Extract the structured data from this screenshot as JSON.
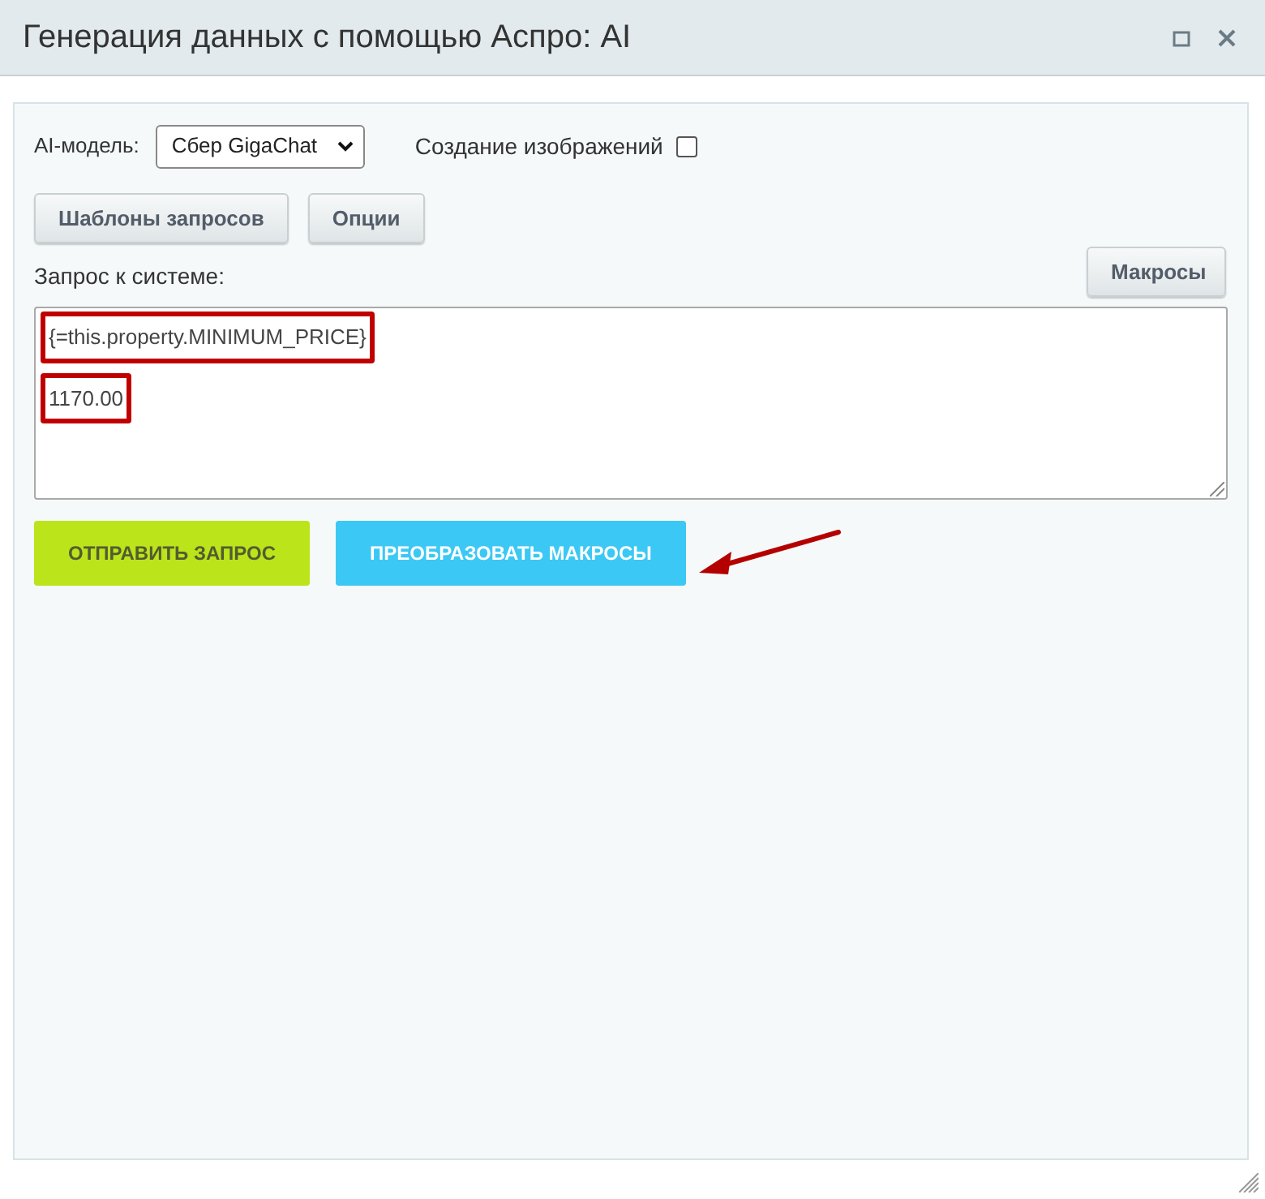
{
  "window": {
    "title": "Генерация данных с помощью Аспро: AI"
  },
  "model": {
    "label": "AI-модель:",
    "value": "Сбер GigaChat"
  },
  "image_option": {
    "label": "Создание изображений",
    "checked": false
  },
  "tool_buttons": [
    "Шаблоны запросов",
    "Опции"
  ],
  "macros_button": "Макросы",
  "request": {
    "label": "Запрос к системе:",
    "lines": [
      {
        "text": "{=this.property.MINIMUM_PRICE}",
        "highlighted": true
      },
      {
        "text": "1170.00",
        "highlighted": true
      }
    ]
  },
  "actions": [
    {
      "label": "ОТПРАВИТЬ ЗАПРОС",
      "kind": "send"
    },
    {
      "label": "ПРЕОБРАЗОВАТЬ МАКРОСЫ",
      "kind": "convert"
    }
  ]
}
